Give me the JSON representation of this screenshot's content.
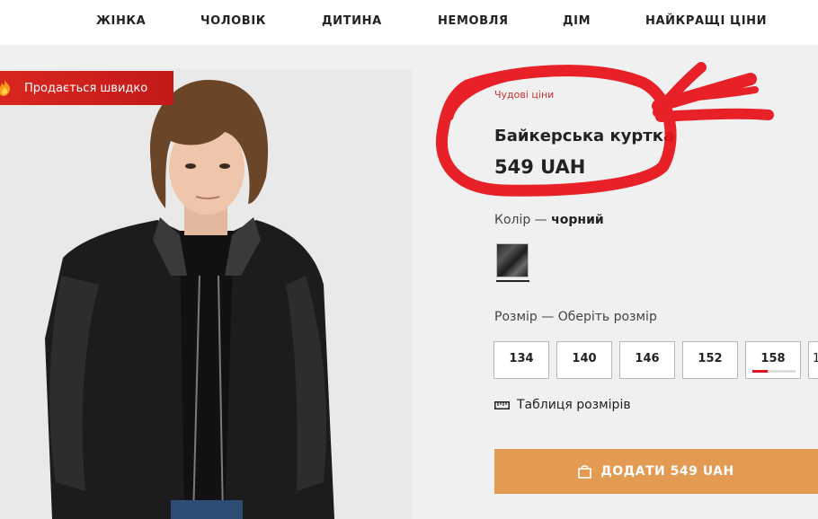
{
  "nav": {
    "items": [
      "ЖІНКА",
      "ЧОЛОВІК",
      "ДИТИНА",
      "НЕМОВЛЯ",
      "ДІМ",
      "НАЙКРАЩІ ЦІНИ"
    ]
  },
  "badge": {
    "text": "Продається швидко",
    "icon": "fire-icon"
  },
  "product": {
    "promo_tag": "Чудові ціни",
    "name": "Байкерська куртка",
    "price": "549 UAH"
  },
  "color": {
    "label": "Колір",
    "dash": " — ",
    "value": "чорний"
  },
  "size": {
    "label": "Розмір",
    "dash": " — ",
    "prompt": "Оберіть розмір",
    "options": [
      "134",
      "140",
      "146",
      "152",
      "158",
      "1"
    ],
    "low_stock_option": "158",
    "low_stock_level": 0.35
  },
  "size_table": {
    "label": "Таблиця розмірів",
    "icon": "ruler-icon"
  },
  "add_button": {
    "label": "ДОДАТИ 549 UAH",
    "icon": "shopping-bag-icon",
    "color": "#e39a52"
  },
  "colors": {
    "badge_red": "#d9261f",
    "stock_red": "#e1121f",
    "annotation_red": "#e8121b"
  }
}
